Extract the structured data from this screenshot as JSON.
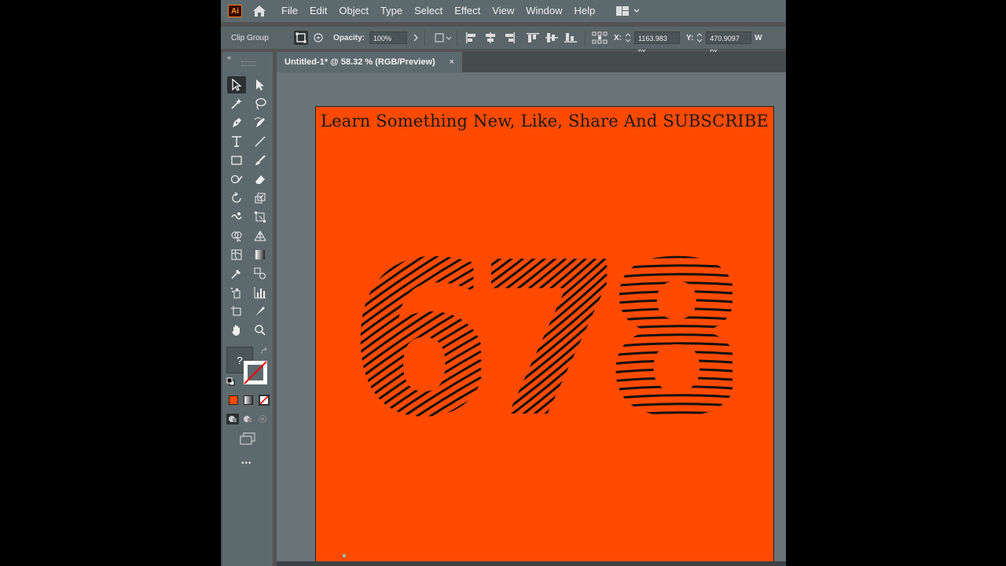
{
  "app": {
    "logo_text": "Ai",
    "accent": "#ff9a00"
  },
  "menu": [
    "File",
    "Edit",
    "Object",
    "Type",
    "Select",
    "Effect",
    "View",
    "Window",
    "Help"
  ],
  "control_bar": {
    "selection_type": "Clip Group",
    "opacity_label": "Opacity:",
    "opacity_value": "100%",
    "x_label": "X:",
    "x_value": "1163.983 px",
    "y_label": "Y:",
    "y_value": "470.9097 px",
    "w_label": "W"
  },
  "document_tab": {
    "title": "Untitled-1* @ 58.32 % (RGB/Preview)",
    "close_glyph": "×"
  },
  "artboard": {
    "background": "#ff4a00",
    "headline": "Learn Something New, Like, Share And SUBSCRIBE",
    "artwork_text": "678"
  },
  "tools": {
    "fill_unknown_glyph": "?",
    "more_glyph": "•••",
    "fill_color": "#ff4a00"
  }
}
